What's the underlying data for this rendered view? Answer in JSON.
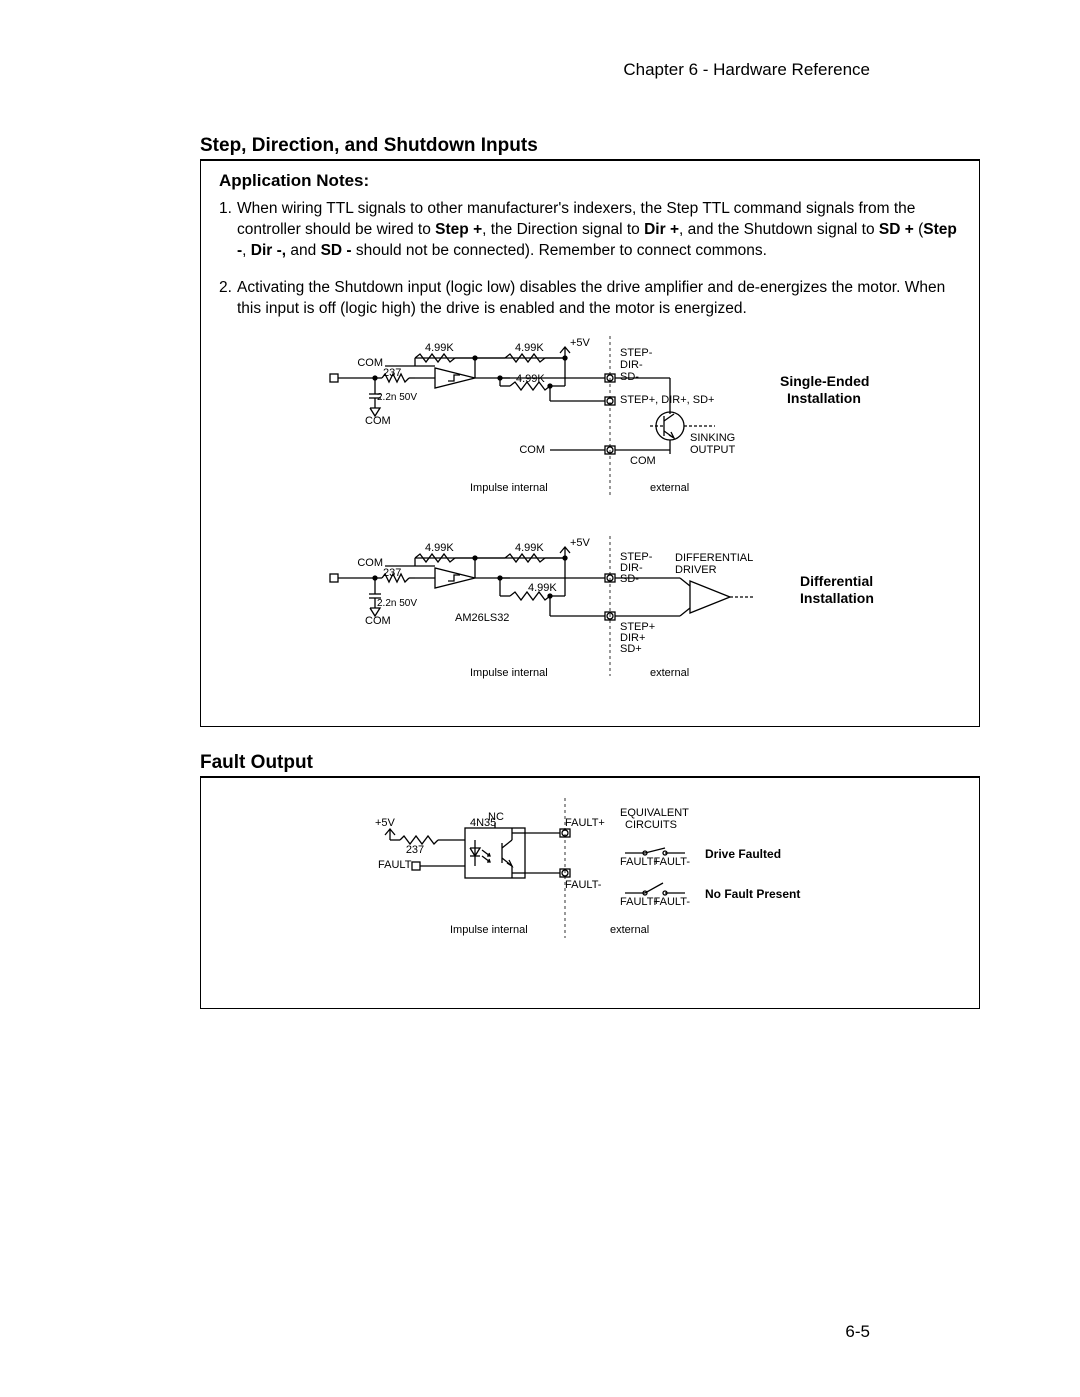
{
  "header": {
    "chapter": "Chapter 6 - Hardware Reference"
  },
  "section1": {
    "title": "Step, Direction, and Shutdown Inputs",
    "app_notes_title": "Application Notes:",
    "note1_num": "1.",
    "note1_a": "When wiring TTL signals to other manufacturer's indexers, the Step TTL command signals from the controller should be wired to ",
    "note1_b": "Step +",
    "note1_c": ", the Direction signal to ",
    "note1_d": "Dir +",
    "note1_e": ",  and  the Shutdown signal to ",
    "note1_f": "SD +",
    "note1_g": " (",
    "note1_h": "Step -",
    "note1_i": ", ",
    "note1_j": "Dir -,",
    "note1_k": " and ",
    "note1_l": "SD -",
    "note1_m": " should not be connected). Remember to connect commons.",
    "note2_num": "2.",
    "note2_body": "Activating the Shutdown input (logic low) disables the drive amplifier and de-energizes the motor. When this input is off (logic high) the drive is enabled and the motor is energized."
  },
  "circuit1": {
    "v5": "+5V",
    "r499k": "4.99K",
    "com": "COM",
    "r237": "237",
    "cap": "2.2n 50V",
    "step_minus": "STEP-",
    "dir_minus": "DIR-",
    "sd_minus": "SD-",
    "step_plus_etc": "STEP+, DIR+, SD+",
    "sinking": "SINKING",
    "output": "OUTPUT",
    "imp_int": "Impulse internal",
    "external": "external",
    "single_ended": "Single-Ended",
    "installation": "Installation"
  },
  "circuit2": {
    "v5": "+5V",
    "r499k": "4.99K",
    "com": "COM",
    "r237": "237",
    "cap": "2.2n 50V",
    "am26": "AM26LS32",
    "step_minus": "STEP-",
    "dir_minus": "DIR-",
    "sd_minus": "SD-",
    "step_plus": "STEP+",
    "dir_plus": "DIR+",
    "sd_plus": "SD+",
    "diff_driver1": "DIFFERENTIAL",
    "diff_driver2": "DRIVER",
    "imp_int": "Impulse internal",
    "external": "external",
    "differential": "Differential",
    "installation": "Installation"
  },
  "section2": {
    "title": "Fault Output"
  },
  "circuit3": {
    "v5": "+5V",
    "r237": "237",
    "n4n35": "4N35",
    "nc": "NC",
    "fault": "FAULT",
    "fault_plus": "FAULT+",
    "fault_minus": "FAULT-",
    "equiv": "EQUIVALENT",
    "circuits": "CIRCUITS",
    "drive_faulted": "Drive Faulted",
    "no_fault": "No Fault Present",
    "imp_int": "Impulse internal",
    "external": "external"
  },
  "footer": {
    "page": "6-5"
  }
}
